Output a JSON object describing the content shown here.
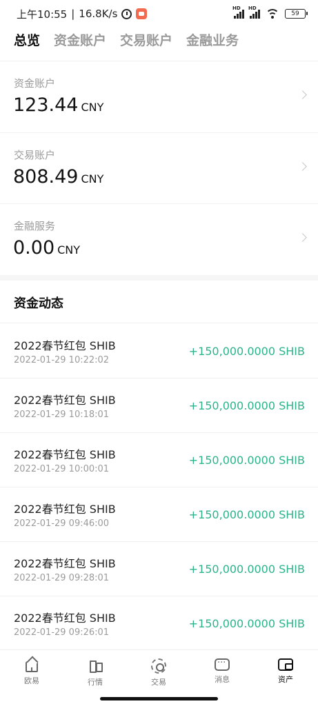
{
  "status": {
    "time": "上午10:55",
    "speed": "16.8K/s",
    "battery": "59",
    "hd": "HD"
  },
  "tabs": [
    "总览",
    "资金账户",
    "交易账户",
    "金融业务"
  ],
  "accounts": [
    {
      "label": "资金账户",
      "value": "123.44",
      "currency": "CNY"
    },
    {
      "label": "交易账户",
      "value": "808.49",
      "currency": "CNY"
    },
    {
      "label": "金融服务",
      "value": "0.00",
      "currency": "CNY"
    }
  ],
  "section_title": "资金动态",
  "transactions": [
    {
      "name": "2022春节红包 SHIB",
      "time": "2022-01-29 10:22:02",
      "amount": "+150,000.0000 SHIB"
    },
    {
      "name": "2022春节红包 SHIB",
      "time": "2022-01-29 10:18:01",
      "amount": "+150,000.0000 SHIB"
    },
    {
      "name": "2022春节红包 SHIB",
      "time": "2022-01-29 10:00:01",
      "amount": "+150,000.0000 SHIB"
    },
    {
      "name": "2022春节红包 SHIB",
      "time": "2022-01-29 09:46:00",
      "amount": "+150,000.0000 SHIB"
    },
    {
      "name": "2022春节红包 SHIB",
      "time": "2022-01-29 09:28:01",
      "amount": "+150,000.0000 SHIB"
    },
    {
      "name": "2022春节红包 SHIB",
      "time": "2022-01-29 09:26:01",
      "amount": "+150,000.0000 SHIB"
    }
  ],
  "nav": [
    {
      "label": "欧易",
      "icon": "home-icon"
    },
    {
      "label": "行情",
      "icon": "candlestick-icon"
    },
    {
      "label": "交易",
      "icon": "trade-icon"
    },
    {
      "label": "消息",
      "icon": "message-icon"
    },
    {
      "label": "资产",
      "icon": "wallet-icon"
    }
  ],
  "colors": {
    "accent_green": "#2bb38a",
    "muted": "#9a9a9a",
    "text": "#111111"
  }
}
